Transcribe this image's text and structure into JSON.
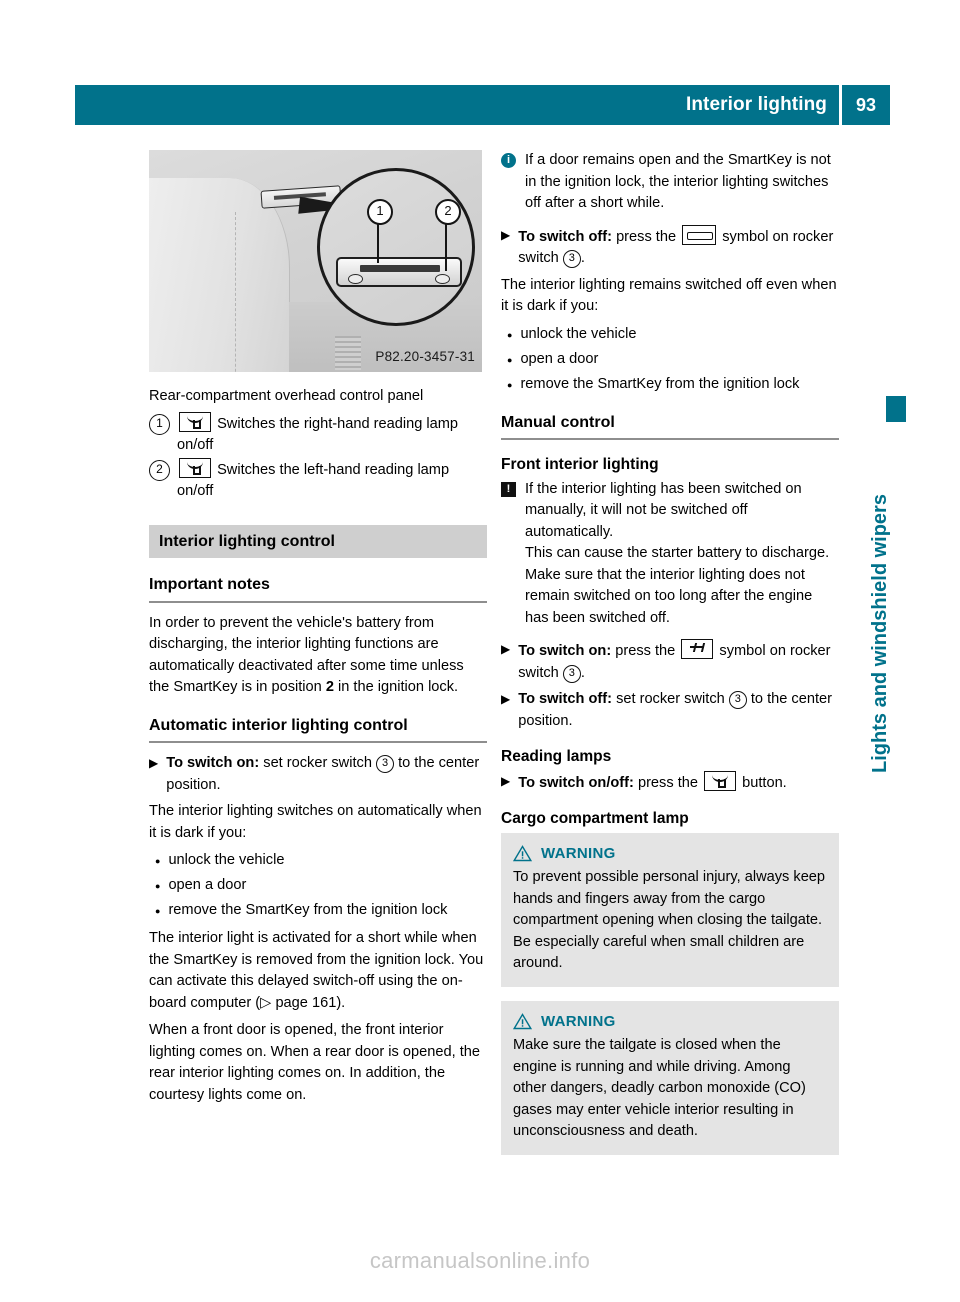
{
  "header": {
    "title": "Interior lighting",
    "page_number": "93",
    "accent_color": "#01728b"
  },
  "chapter_tab": {
    "label": "Lights and windshield wipers"
  },
  "figure": {
    "code": "P82.20-3457-31",
    "caption": "Rear-compartment overhead control panel",
    "callouts": [
      "1",
      "2"
    ],
    "legend": [
      {
        "num": "1",
        "symbol": "reading-lamp-icon",
        "text": "Switches the right-hand reading lamp on/off"
      },
      {
        "num": "2",
        "symbol": "reading-lamp-icon",
        "text": "Switches the left-hand reading lamp on/off"
      }
    ]
  },
  "left_column": {
    "band_title": "Interior lighting control",
    "important_notes_head": "Important notes",
    "important_notes_body": "In order to prevent the vehicle's battery from discharging, the interior lighting functions are automatically deactivated after some time unless the SmartKey is in position 2 in the ignition lock.",
    "important_notes_bold_part": "2",
    "automatic_head": "Automatic interior lighting control",
    "switch_on_label": "To switch on:",
    "switch_on_text_a": "set rocker switch",
    "switch_on_rocker": "3",
    "switch_on_text_b": "to the center position.",
    "auto_intro": "The interior lighting switches on automatically when it is dark if you:",
    "auto_bullets": [
      "unlock the vehicle",
      "open a door",
      "remove the SmartKey from the ignition lock"
    ],
    "delayed_para_a": "The interior light is activated for a short while when the SmartKey is removed from the ignition lock. You can activate this delayed switch-off using the on-board computer",
    "page_ref": "page 161",
    "delayed_para_b": "When a front door is opened, the front interior lighting comes on. When a rear door is opened, the rear interior lighting comes on. In addition, the courtesy lights come on."
  },
  "right_column": {
    "info_note": "If a door remains open and the SmartKey is not in the ignition lock, the interior lighting switches off after a short while.",
    "switch_off_label": "To switch off:",
    "switch_off_text_a": "press the",
    "switch_off_text_b": "symbol on rocker switch",
    "switch_off_rocker": "3",
    "switch_off_period": ".",
    "remains_off_intro": "The interior lighting remains switched off even when it is dark if you:",
    "remains_off_bullets": [
      "unlock the vehicle",
      "open a door",
      "remove the SmartKey from the ignition lock"
    ],
    "manual_control_head": "Manual control",
    "front_interior_head": "Front interior lighting",
    "warn_note_1": "If the interior lighting has been switched on manually, it will not be switched off automatically.",
    "warn_note_2": "This can cause the starter battery to discharge.",
    "warn_note_3": "Make sure that the interior lighting does not remain switched on too long after the engine has been switched off.",
    "manual_on_label": "To switch on:",
    "manual_on_text_a": "press the",
    "manual_on_text_b": "symbol on rocker switch",
    "manual_on_rocker": "3",
    "manual_off_label": "To switch off:",
    "manual_off_text_a": "set rocker switch",
    "manual_off_rocker": "3",
    "manual_off_text_b": "to the center position.",
    "reading_lamps_head": "Reading lamps",
    "reading_on_off_label": "To switch on/off:",
    "reading_on_off_text_a": "press the",
    "reading_on_off_text_b": "button.",
    "cargo_head": "Cargo compartment lamp",
    "warnings": [
      {
        "label": "WARNING",
        "text": "To prevent possible personal injury, always keep hands and fingers away from the cargo compartment opening when closing the tailgate. Be especially careful when small children are around."
      },
      {
        "label": "WARNING",
        "text": "Make sure the tailgate is closed when the engine is running and while driving. Among other dangers, deadly carbon monoxide (CO) gases may enter vehicle interior resulting in unconsciousness and death."
      }
    ]
  },
  "footer": {
    "watermark": "carmanualsonline.info"
  }
}
